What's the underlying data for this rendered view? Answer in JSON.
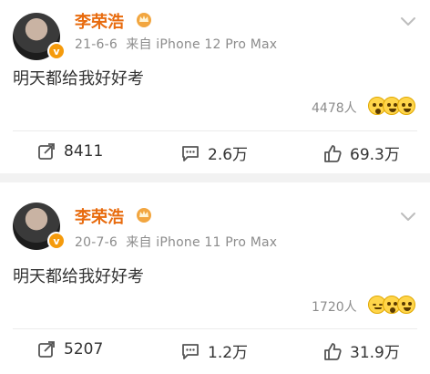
{
  "posts": [
    {
      "author": "李荣浩",
      "date": "21-6-6",
      "source": "来自 iPhone 12 Pro Max",
      "text": "明天都给我好好考",
      "reactions_count": "4478人",
      "repost": "8411",
      "comments": "2.6万",
      "likes": "69.3万"
    },
    {
      "author": "李荣浩",
      "date": "20-7-6",
      "source": "来自 iPhone 11 Pro Max",
      "text": "明天都给我好好考",
      "reactions_count": "1720人",
      "repost": "5207",
      "comments": "1.2万",
      "likes": "31.9万"
    }
  ],
  "icons": {
    "avatar_badge": "v",
    "crown": "crown-icon",
    "menu": "chevron-down-icon",
    "repost": "share-icon",
    "comment": "comment-icon",
    "like": "thumbs-up-icon"
  },
  "colors": {
    "name": "#e86b0e",
    "meta": "#8c8c8c",
    "text": "#333333",
    "background": "#f2f2f2"
  }
}
